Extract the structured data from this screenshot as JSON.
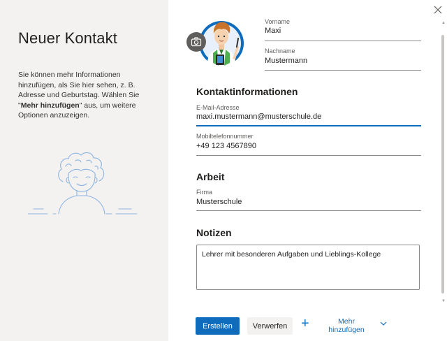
{
  "left": {
    "title": "Neuer Kontakt",
    "desc_part1": "Sie können mehr Informationen hinzufügen, als Sie hier sehen, z. B. Adresse und Geburtstag. Wählen Sie \"",
    "desc_bold": "Mehr hinzufügen",
    "desc_part2": "\" aus, um weitere Optionen anzuzeigen."
  },
  "form": {
    "vorname_label": "Vorname",
    "vorname_value": "Maxi",
    "nachname_label": "Nachname",
    "nachname_value": "Mustermann",
    "contact_heading": "Kontaktinformationen",
    "email_label": "E-Mail-Adresse",
    "email_value": "maxi.mustermann@musterschule.de",
    "mobile_label": "Mobiltelefonnummer",
    "mobile_value": "+49 123 4567890",
    "work_heading": "Arbeit",
    "firma_label": "Firma",
    "firma_value": "Musterschule",
    "notes_heading": "Notizen",
    "notes_value": "Lehrer mit besonderen Aufgaben und Lieblings-Kollege"
  },
  "actions": {
    "create_label": "Erstellen",
    "discard_label": "Verwerfen",
    "more_label": "Mehr hinzufügen"
  },
  "icons": {
    "close": "close-icon",
    "camera": "camera-icon",
    "plus": "plus-icon",
    "chevron": "chevron-down-icon"
  },
  "colors": {
    "accent": "#0f6cbd",
    "left_pane_bg": "#f3f2f1",
    "illustration_stroke": "#8cb4e0"
  }
}
